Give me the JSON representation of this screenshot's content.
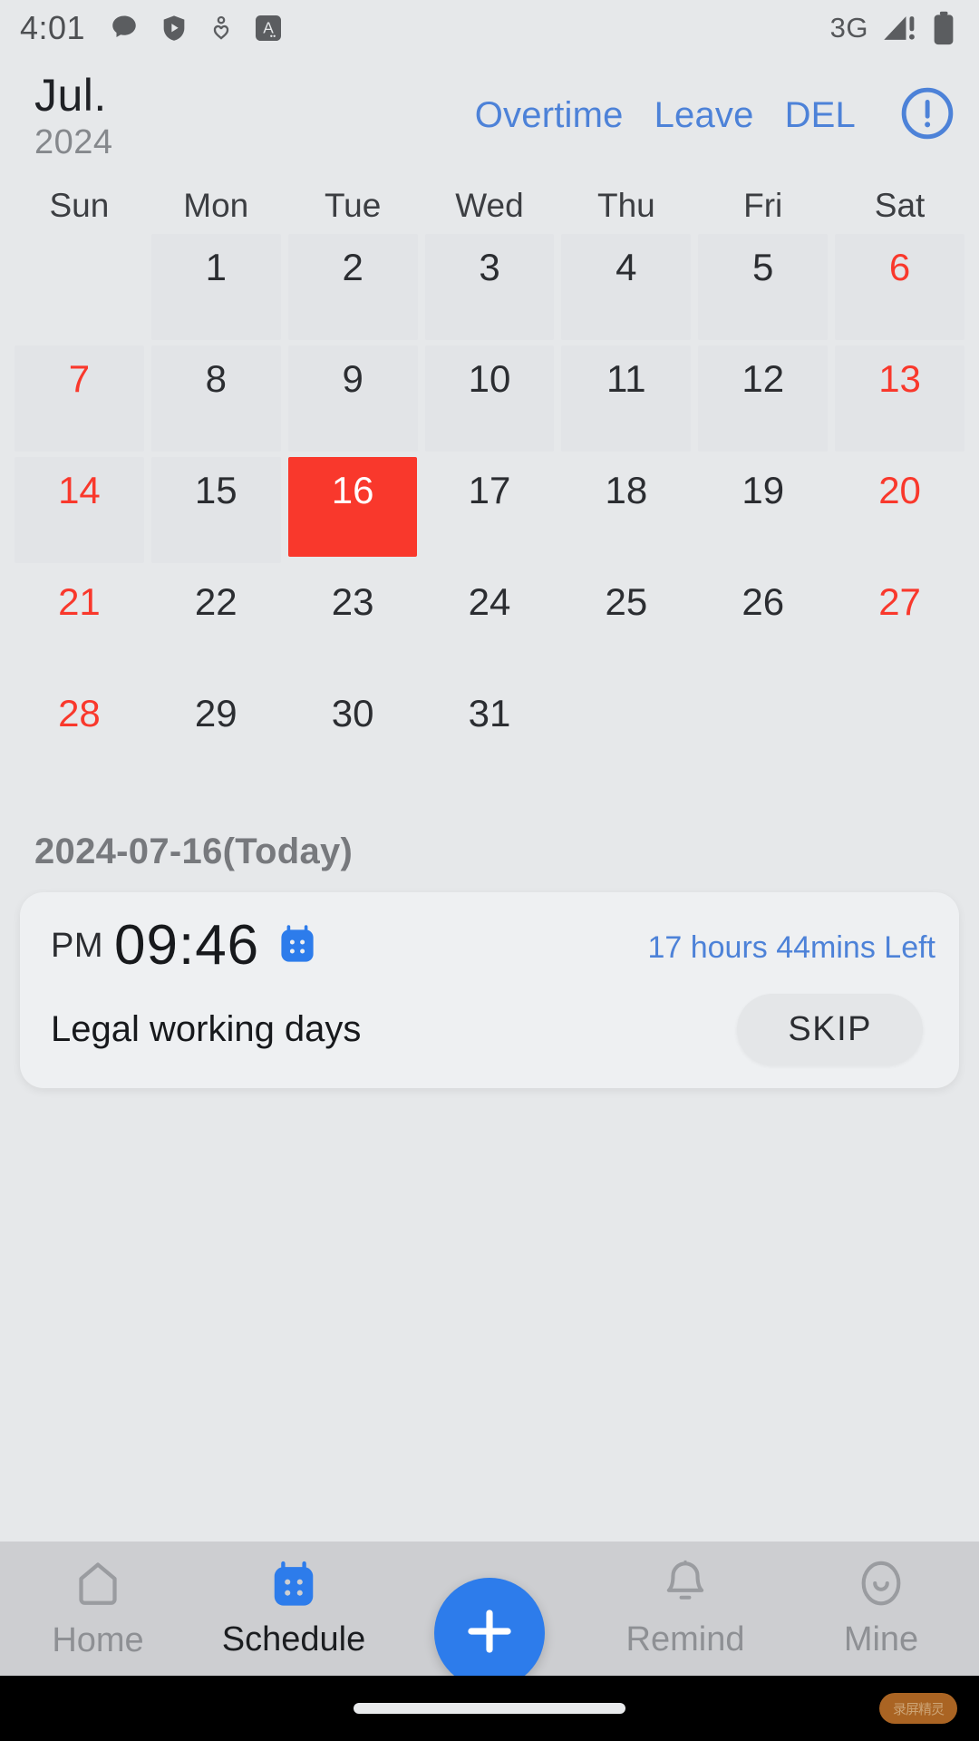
{
  "status_bar": {
    "time": "4:01",
    "left_icons": [
      "speech-bubble-icon",
      "shield-play-icon",
      "person-heart-icon",
      "a-badge-icon"
    ],
    "network": "3G",
    "signal_icon": "signal-warning-icon",
    "battery_icon": "battery-full-icon"
  },
  "header": {
    "month": "Jul.",
    "year": "2024",
    "actions": [
      {
        "label": "Overtime",
        "name": "overtime-button"
      },
      {
        "label": "Leave",
        "name": "leave-button"
      },
      {
        "label": "DEL",
        "name": "del-button"
      }
    ],
    "info_icon": "exclamation-circle-icon"
  },
  "calendar": {
    "weekdays": [
      "Sun",
      "Mon",
      "Tue",
      "Wed",
      "Thu",
      "Fri",
      "Sat"
    ],
    "selected_day": 16,
    "rows": [
      [
        {
          "day": "",
          "weekend": false,
          "tint": false,
          "selected": false
        },
        {
          "day": "1",
          "weekend": false,
          "tint": true,
          "selected": false
        },
        {
          "day": "2",
          "weekend": false,
          "tint": true,
          "selected": false
        },
        {
          "day": "3",
          "weekend": false,
          "tint": true,
          "selected": false
        },
        {
          "day": "4",
          "weekend": false,
          "tint": true,
          "selected": false
        },
        {
          "day": "5",
          "weekend": false,
          "tint": true,
          "selected": false
        },
        {
          "day": "6",
          "weekend": true,
          "tint": true,
          "selected": false
        }
      ],
      [
        {
          "day": "7",
          "weekend": true,
          "tint": true,
          "selected": false
        },
        {
          "day": "8",
          "weekend": false,
          "tint": true,
          "selected": false
        },
        {
          "day": "9",
          "weekend": false,
          "tint": true,
          "selected": false
        },
        {
          "day": "10",
          "weekend": false,
          "tint": true,
          "selected": false
        },
        {
          "day": "11",
          "weekend": false,
          "tint": true,
          "selected": false
        },
        {
          "day": "12",
          "weekend": false,
          "tint": true,
          "selected": false
        },
        {
          "day": "13",
          "weekend": true,
          "tint": true,
          "selected": false
        }
      ],
      [
        {
          "day": "14",
          "weekend": true,
          "tint": true,
          "selected": false
        },
        {
          "day": "15",
          "weekend": false,
          "tint": true,
          "selected": false
        },
        {
          "day": "16",
          "weekend": false,
          "tint": false,
          "selected": true
        },
        {
          "day": "17",
          "weekend": false,
          "tint": false,
          "selected": false
        },
        {
          "day": "18",
          "weekend": false,
          "tint": false,
          "selected": false
        },
        {
          "day": "19",
          "weekend": false,
          "tint": false,
          "selected": false
        },
        {
          "day": "20",
          "weekend": true,
          "tint": false,
          "selected": false
        }
      ],
      [
        {
          "day": "21",
          "weekend": true,
          "tint": false,
          "selected": false
        },
        {
          "day": "22",
          "weekend": false,
          "tint": false,
          "selected": false
        },
        {
          "day": "23",
          "weekend": false,
          "tint": false,
          "selected": false
        },
        {
          "day": "24",
          "weekend": false,
          "tint": false,
          "selected": false
        },
        {
          "day": "25",
          "weekend": false,
          "tint": false,
          "selected": false
        },
        {
          "day": "26",
          "weekend": false,
          "tint": false,
          "selected": false
        },
        {
          "day": "27",
          "weekend": true,
          "tint": false,
          "selected": false
        }
      ],
      [
        {
          "day": "28",
          "weekend": true,
          "tint": false,
          "selected": false
        },
        {
          "day": "29",
          "weekend": false,
          "tint": false,
          "selected": false
        },
        {
          "day": "30",
          "weekend": false,
          "tint": false,
          "selected": false
        },
        {
          "day": "31",
          "weekend": false,
          "tint": false,
          "selected": false
        },
        {
          "day": "",
          "weekend": false,
          "tint": false,
          "selected": false
        },
        {
          "day": "",
          "weekend": false,
          "tint": false,
          "selected": false
        },
        {
          "day": "",
          "weekend": false,
          "tint": false,
          "selected": false
        }
      ]
    ]
  },
  "today_label": "2024-07-16(Today)",
  "schedule_card": {
    "ampm": "PM",
    "time": "09:46",
    "calendar_icon": "calendar-icon",
    "time_left": "17 hours 44mins Left",
    "work_type": "Legal working days",
    "skip_label": "SKIP"
  },
  "bottom_nav": {
    "items": [
      {
        "label": "Home",
        "icon": "home-icon",
        "name": "nav-home",
        "active": false
      },
      {
        "label": "Schedule",
        "icon": "calendar-icon",
        "name": "nav-schedule",
        "active": true
      },
      {
        "label": "Remind",
        "icon": "bell-icon",
        "name": "nav-remind",
        "active": false
      },
      {
        "label": "Mine",
        "icon": "person-icon",
        "name": "nav-mine",
        "active": false
      }
    ],
    "fab_icon": "plus-icon"
  },
  "watermark": "录屏精灵",
  "colors": {
    "accent_blue": "#4d82d8",
    "selected_red": "#f9382c",
    "fab_blue": "#2d7ceb",
    "background": "#e6e8ea",
    "nav_background": "#cdced1"
  }
}
